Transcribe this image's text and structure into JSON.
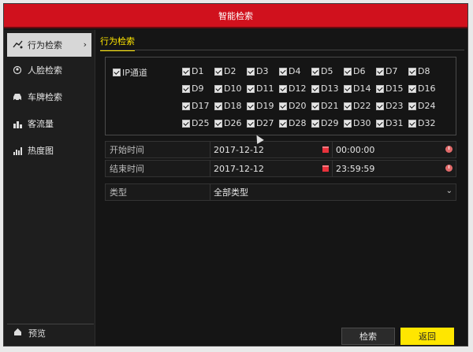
{
  "window": {
    "title": "智能检索"
  },
  "sidebar": {
    "items": [
      {
        "label": "行为检索",
        "icon": "behavior-icon",
        "active": true
      },
      {
        "label": "人脸检索",
        "icon": "face-icon"
      },
      {
        "label": "车牌检索",
        "icon": "car-icon"
      },
      {
        "label": "客流量",
        "icon": "people-count-icon"
      },
      {
        "label": "热度图",
        "icon": "heatmap-icon"
      }
    ],
    "footer": {
      "label": "预览",
      "icon": "home-icon"
    }
  },
  "main": {
    "tab": "行为检索",
    "channels": {
      "all_label": "IP通道",
      "all_checked": true,
      "list": [
        "D1",
        "D2",
        "D3",
        "D4",
        "D5",
        "D6",
        "D7",
        "D8",
        "D9",
        "D10",
        "D11",
        "D12",
        "D13",
        "D14",
        "D15",
        "D16",
        "D17",
        "D18",
        "D19",
        "D20",
        "D21",
        "D22",
        "D23",
        "D24",
        "D25",
        "D26",
        "D27",
        "D28",
        "D29",
        "D30",
        "D31",
        "D32"
      ]
    },
    "start": {
      "label": "开始时间",
      "date": "2017-12-12",
      "time": "00:00:00"
    },
    "end": {
      "label": "结束时间",
      "date": "2017-12-12",
      "time": "23:59:59"
    },
    "type": {
      "label": "类型",
      "value": "全部类型"
    },
    "buttons": {
      "search": "检索",
      "back": "返回"
    }
  },
  "colors": {
    "title_bar": "#d0111d",
    "accent": "#ffe600"
  }
}
